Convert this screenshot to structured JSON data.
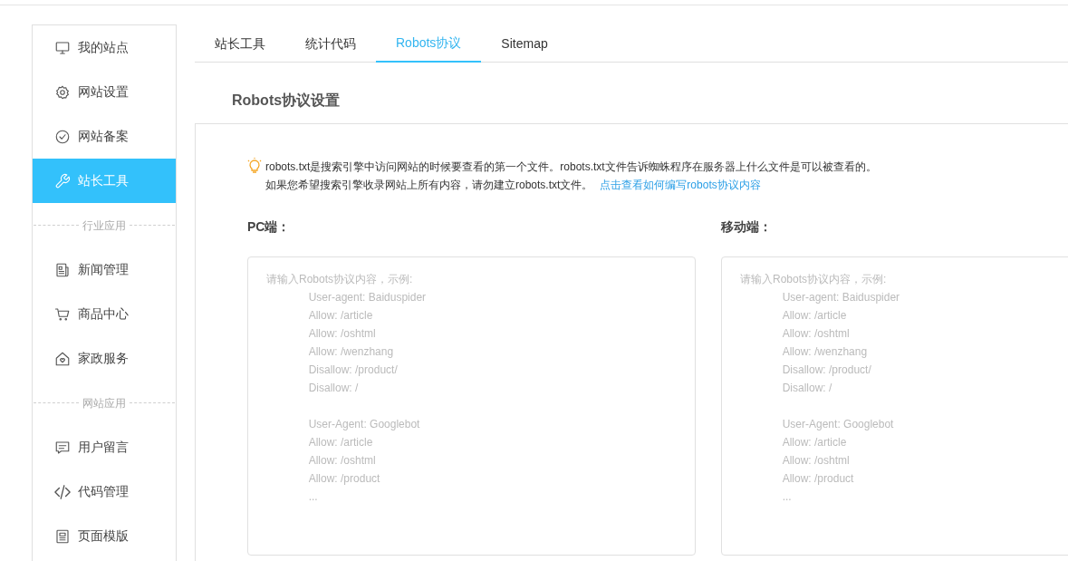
{
  "sidebar": {
    "items": [
      {
        "kind": "item",
        "label": "我的站点",
        "selected": false
      },
      {
        "kind": "item",
        "label": "网站设置",
        "selected": false
      },
      {
        "kind": "item",
        "label": "网站备案",
        "selected": false
      },
      {
        "kind": "item",
        "label": "站长工具",
        "selected": true
      },
      {
        "kind": "divider",
        "label": "行业应用"
      },
      {
        "kind": "item",
        "label": "新闻管理",
        "selected": false
      },
      {
        "kind": "item",
        "label": "商品中心",
        "selected": false
      },
      {
        "kind": "item",
        "label": "家政服务",
        "selected": false
      },
      {
        "kind": "divider",
        "label": "网站应用"
      },
      {
        "kind": "item",
        "label": "用户留言",
        "selected": false
      },
      {
        "kind": "item",
        "label": "代码管理",
        "selected": false
      },
      {
        "kind": "item",
        "label": "页面模版",
        "selected": false
      }
    ]
  },
  "tabs": [
    {
      "label": "站长工具",
      "selected": false
    },
    {
      "label": "统计代码",
      "selected": false
    },
    {
      "label": "Robots协议",
      "selected": true
    },
    {
      "label": "Sitemap",
      "selected": false
    }
  ],
  "section_title": "Robots协议设置",
  "notice": {
    "line_1": "robots.txt是搜索引擎中访问网站的时候要查看的第一个文件。robots.txt文件告诉蜘蛛程序在服务器上什么文件是可以被查看的。",
    "line_2": "如果您希望搜索引擎收录网站上所有内容，请勿建立robots.txt文件。",
    "link": "点击查看如何编写robots协议内容"
  },
  "fields": [
    {
      "label": "PC端：",
      "placeholder": "请输入Robots协议内容，示例:\n              User-agent: Baiduspider\n              Allow: /article\n              Allow: /oshtml\n              Allow: /wenzhang\n              Disallow: /product/\n              Disallow: /\n\n              User-Agent: Googlebot\n              Allow: /article\n              Allow: /oshtml\n              Allow: /product\n              ..."
    },
    {
      "label": "移动端：",
      "placeholder": "请输入Robots协议内容，示例:\n              User-agent: Baiduspider\n              Allow: /article\n              Allow: /oshtml\n              Allow: /wenzhang\n              Disallow: /product/\n              Disallow: /\n\n              User-Agent: Googlebot\n              Allow: /article\n              Allow: /oshtml\n              Allow: /product\n              ..."
    }
  ]
}
